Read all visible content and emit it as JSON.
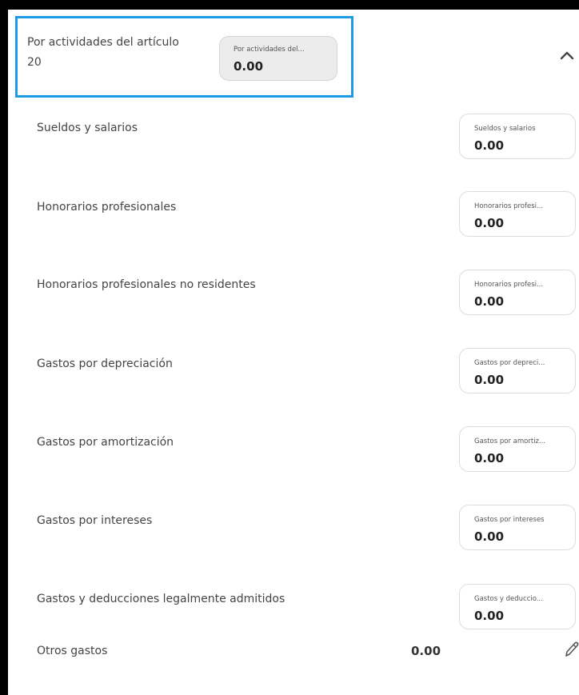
{
  "header": {
    "label": "Por actividades del artículo 20",
    "field_caption": "Por actividades del...",
    "field_value": "0.00"
  },
  "icons": {
    "collapse": "chevron-up-icon",
    "edit": "pencil-icon"
  },
  "colors": {
    "highlight_border": "#1e9be6",
    "field_bg": "#ececec"
  },
  "rows": [
    {
      "label": "Sueldos y salarios",
      "caption": "Sueldos y salarios",
      "value": "0.00"
    },
    {
      "label": "Honorarios profesionales",
      "caption": "Honorarios profesi...",
      "value": "0.00"
    },
    {
      "label": "Honorarios profesionales no residentes",
      "caption": "Honorarios profesi...",
      "value": "0.00"
    },
    {
      "label": "Gastos por depreciación",
      "caption": "Gastos por depreci...",
      "value": "0.00"
    },
    {
      "label": "Gastos por amortización",
      "caption": "Gastos por amortiz...",
      "value": "0.00"
    },
    {
      "label": "Gastos por intereses",
      "caption": "Gastos por intereses",
      "value": "0.00"
    },
    {
      "label": "Gastos y deducciones legalmente admitidos",
      "caption": "Gastos y deduccio...",
      "value": "0.00"
    }
  ],
  "otros": {
    "label": "Otros gastos",
    "value": "0.00"
  }
}
